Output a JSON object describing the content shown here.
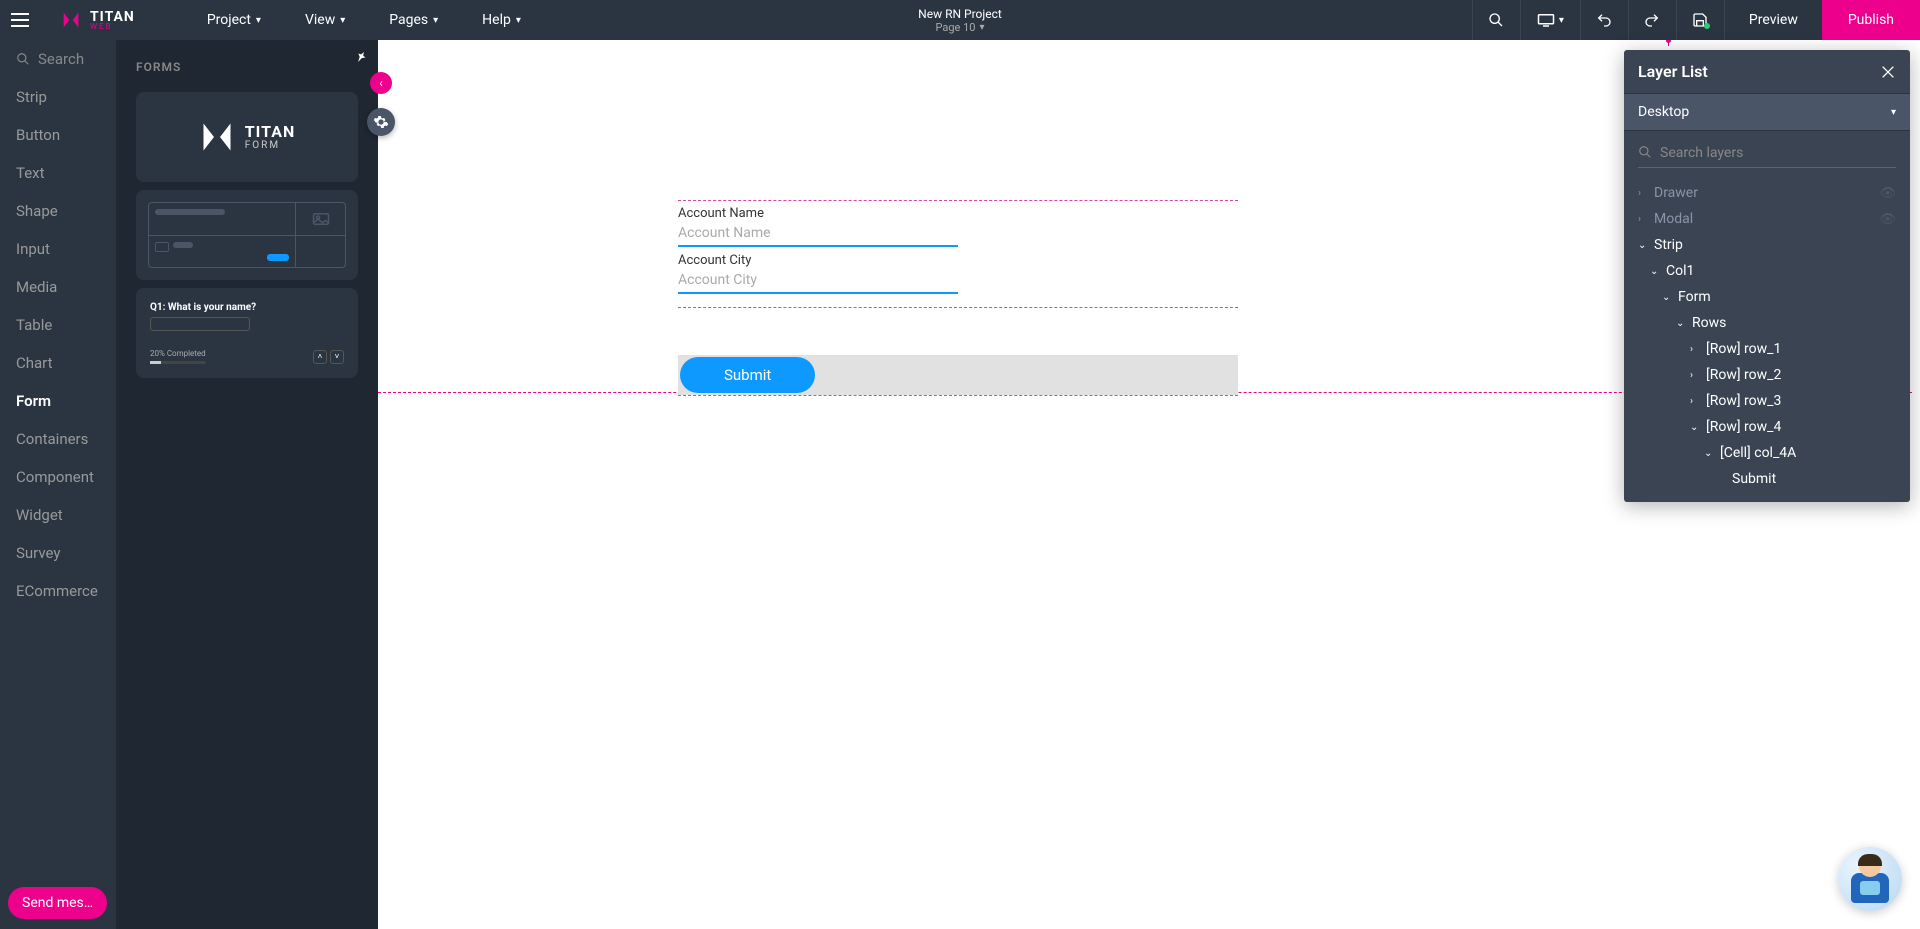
{
  "brand": {
    "name": "TITAN",
    "sub": "WEB"
  },
  "menu": {
    "project": "Project",
    "view": "View",
    "pages": "Pages",
    "help": "Help"
  },
  "header": {
    "project_name": "New RN Project",
    "page_label": "Page 10",
    "preview": "Preview",
    "publish": "Publish"
  },
  "left_rail": {
    "search_placeholder": "Search",
    "items": [
      "Strip",
      "Button",
      "Text",
      "Shape",
      "Input",
      "Media",
      "Table",
      "Chart",
      "Form",
      "Containers",
      "Component",
      "Widget",
      "Survey",
      "ECommerce"
    ],
    "active": "Form"
  },
  "sec_panel": {
    "title": "FORMS",
    "form_logo_text": "TITAN",
    "form_logo_sub": "FORM",
    "q_label": "Q1: What is your name?",
    "q_progress": "20% Completed"
  },
  "canvas": {
    "fields": [
      {
        "label": "Account Name",
        "placeholder": "Account Name"
      },
      {
        "label": "Account City",
        "placeholder": "Account City"
      }
    ],
    "submit": "Submit"
  },
  "layer_panel": {
    "title": "Layer List",
    "device": "Desktop",
    "search_placeholder": "Search layers",
    "tree": {
      "drawer": "Drawer",
      "modal": "Modal",
      "strip": "Strip",
      "col1": "Col1",
      "form": "Form",
      "rows": "Rows",
      "row1": "[Row] row_1",
      "row2": "[Row] row_2",
      "row3": "[Row] row_3",
      "row4": "[Row] row_4",
      "cell4a": "[Cell] col_4A",
      "submit": "Submit"
    }
  },
  "send_msg": "Send mes…"
}
